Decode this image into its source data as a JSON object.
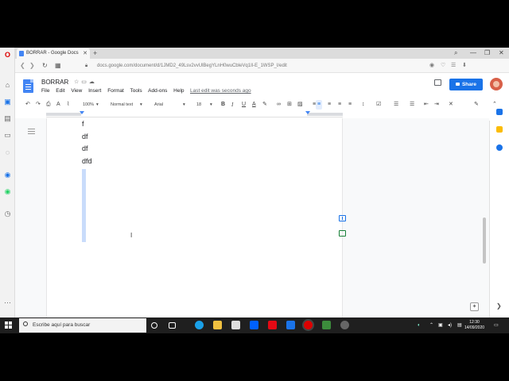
{
  "browser": {
    "tab_title": "BORRAR - Google Docs",
    "tab_close": "✕",
    "new_tab": "+",
    "url": "docs.google.com/document/d/1JMD2_49Lsv2vvUlBegYLnH0wuCbleVq1Il-E_1WSP_I/edit",
    "window_controls": [
      "⌕",
      "—",
      "❐",
      "✕"
    ]
  },
  "docs": {
    "title": "BORRAR",
    "menu": [
      "File",
      "Edit",
      "View",
      "Insert",
      "Format",
      "Tools",
      "Add-ons",
      "Help"
    ],
    "last_edit": "Last edit was seconds ago",
    "share_label": "Share",
    "toolbar": {
      "zoom": "100%",
      "style": "Normal text",
      "font": "Arial",
      "size": "18"
    },
    "content_lines": [
      "f",
      "df",
      "df",
      "dfd"
    ],
    "colors": {
      "brand_blue": "#1a73e8",
      "selection": "#c9dcfb"
    }
  },
  "taskbar": {
    "search_placeholder": "Escribe aquí para buscar",
    "time": "12:30",
    "date": "14/09/2020"
  }
}
